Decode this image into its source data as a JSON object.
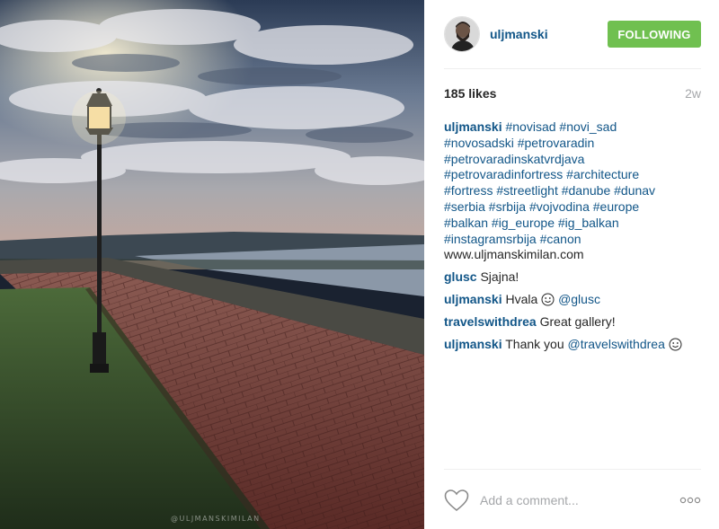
{
  "post": {
    "author": "uljmanski",
    "follow_label": "FOLLOWING",
    "likes": "185 likes",
    "time": "2w",
    "watermark": "@ULJMANSKIMILAN"
  },
  "caption": {
    "user": "uljmanski",
    "tags_line1": "#novisad #novi_sad",
    "tags_line2": "#novosadski #petrovaradin",
    "tags_line3": "#petrovaradinskatvrdjava",
    "tags_line4": "#petrovaradinfortress #architecture",
    "tags_line5": "#fortress #streetlight #danube #dunav",
    "tags_line6": "#serbia #srbija #vojvodina #europe",
    "tags_line7": "#balkan #ig_europe #ig_balkan",
    "tags_line8": "#instagramsrbija #canon",
    "website": "www.uljmanskimilan.com"
  },
  "comments": [
    {
      "user": "glusc",
      "text": "Sjajna!"
    },
    {
      "user": "uljmanski",
      "text": "Hvala",
      "mention": "@glusc"
    },
    {
      "user": "travelswithdrea",
      "text": "Great gallery!"
    },
    {
      "user": "uljmanski",
      "text": "Thank you",
      "mention": "@travelswithdrea"
    }
  ],
  "composer": {
    "placeholder": "Add a comment..."
  },
  "icons": {
    "like": "heart-outline-icon",
    "more": "ellipsis-icon",
    "emoji": "smiley-icon"
  },
  "colors": {
    "link": "#125688",
    "follow": "#70c050",
    "muted": "#a5a7aa"
  }
}
